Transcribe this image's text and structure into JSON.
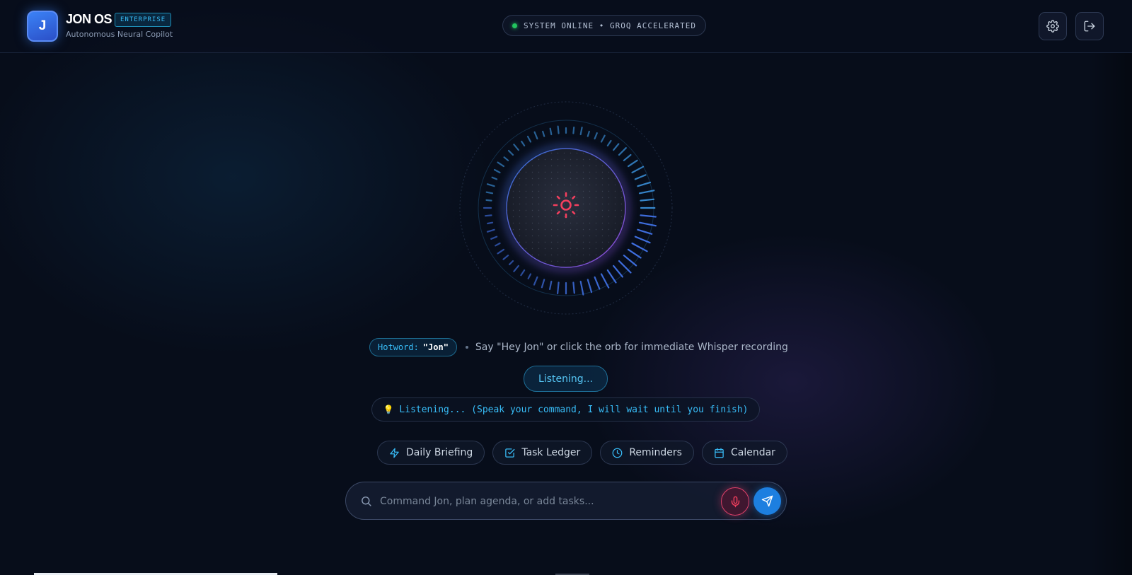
{
  "header": {
    "logo_letter": "J",
    "title": "JON OS",
    "badge": "ENTERPRISE",
    "subtitle": "Autonomous Neural Copilot",
    "status": "SYSTEM ONLINE • GROQ ACCELERATED",
    "icons": [
      "gear-icon",
      "logout-icon"
    ]
  },
  "orb": {
    "center_icon": "sun-icon",
    "state": "listening"
  },
  "hotword": {
    "label": "Hotword:",
    "value": "\"Jon\"",
    "hint": "Say \"Hey Jon\" or click the orb for immediate Whisper recording"
  },
  "listen_button": "Listening...",
  "transcript": {
    "icon": "💡",
    "text": "Listening... (Speak your command, I will wait until you finish)"
  },
  "quick_actions": [
    {
      "label": "Daily Briefing",
      "icon": "lightning-icon"
    },
    {
      "label": "Task Ledger",
      "icon": "checkbox-icon"
    },
    {
      "label": "Reminders",
      "icon": "clock-icon"
    },
    {
      "label": "Calendar",
      "icon": "calendar-icon"
    }
  ],
  "command": {
    "placeholder": "Command Jon, plan agenda, or add tasks...",
    "value": ""
  },
  "colors": {
    "accent": "#38bdf8",
    "primary": "#3b82f6",
    "mic": "#e0406a",
    "online": "#22c55e",
    "background": "#070d1a"
  }
}
